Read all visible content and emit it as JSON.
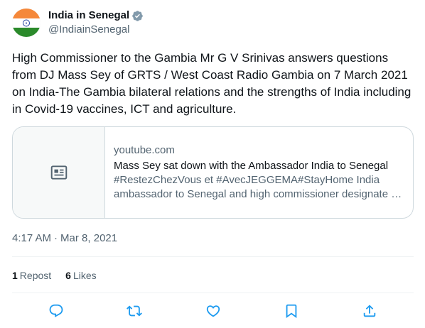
{
  "account": {
    "display_name": "India in Senegal",
    "handle": "@IndiainSenegal",
    "verified_icon": "verified-badge-icon",
    "avatar_flag_colors": {
      "saffron": "#f5883a",
      "white": "#ffffff",
      "green": "#2b8a2b",
      "chakra": "#1d3f9e"
    }
  },
  "tweet": {
    "text": "High Commissioner to the Gambia Mr G V Srinivas  answers questions from DJ Mass Sey of GRTS / West Coast Radio Gambia on 7 March 2021 on India-The Gambia bilateral relations and the strengths of India including in Covid-19 vaccines, ICT and agriculture.",
    "time": "4:17 AM",
    "separator": "·",
    "date": "Mar 8, 2021"
  },
  "card": {
    "domain": "youtube.com",
    "title": "Mass Sey sat down with the Ambassador India to Senegal",
    "description": "#RestezChezVous et #AvecJEGGEMA#StayHome India ambassador to Senegal and high commissioner designate for Gambia was interviewed by DJ Mass Sey",
    "thumb_icon": "article-icon"
  },
  "stats": {
    "reposts_count": "1",
    "reposts_label": "Repost",
    "likes_count": "6",
    "likes_label": "Likes"
  },
  "actions": [
    "reply-icon",
    "repost-icon",
    "like-icon",
    "bookmark-icon",
    "share-icon"
  ],
  "colors": {
    "text": "#0f1419",
    "secondary": "#536471",
    "border": "#cfd9de",
    "verified": "#829aab"
  }
}
